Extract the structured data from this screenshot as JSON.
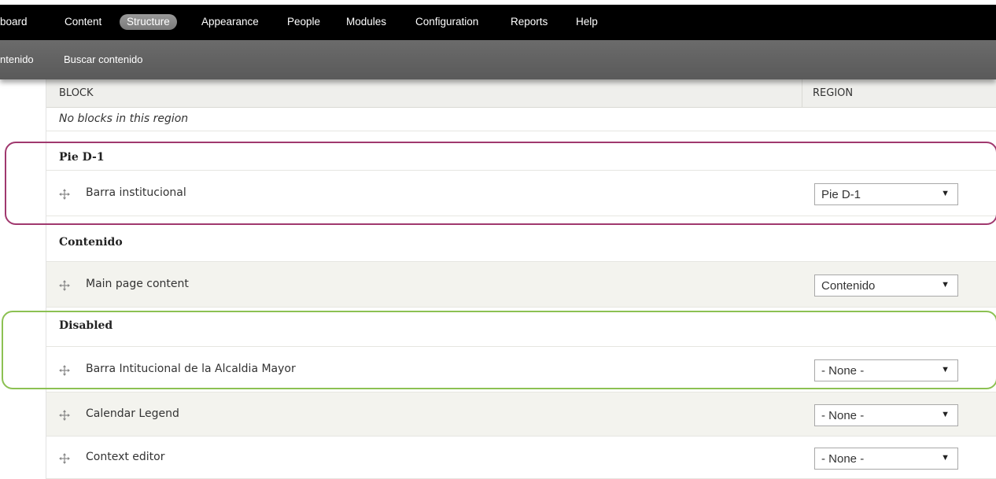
{
  "admin_menu": {
    "items": [
      "board",
      "Content",
      "Structure",
      "Appearance",
      "People",
      "Modules",
      "Configuration",
      "Reports",
      "Help"
    ],
    "active": "Structure"
  },
  "shortcuts": {
    "items": [
      "ntenido",
      "Buscar contenido"
    ]
  },
  "table": {
    "headers": {
      "block": "BLOCK",
      "region": "REGION"
    },
    "empty_message": "No blocks in this region",
    "sections": [
      {
        "title": "Pie D-1",
        "blocks": [
          {
            "label": "Barra institucional",
            "region": "Pie D-1"
          }
        ]
      },
      {
        "title": "Contenido",
        "blocks": [
          {
            "label": "Main page content",
            "region": "Contenido"
          }
        ]
      },
      {
        "title": "Disabled",
        "blocks": [
          {
            "label": "Barra Intitucional de la Alcaldia Mayor",
            "region": "- None -"
          },
          {
            "label": "Calendar Legend",
            "region": "- None -"
          },
          {
            "label": "Context editor",
            "region": "- None -"
          }
        ]
      }
    ]
  },
  "icons": {
    "drag": "move-arrows-icon",
    "select_arrow": "triangle-down-icon"
  },
  "colors": {
    "admin_bar": "#000000",
    "shortcut_bar": "#666666",
    "active_tab": "#8a8a8a",
    "highlight_pie": "#a0386e",
    "highlight_disabled": "#8cc152"
  }
}
